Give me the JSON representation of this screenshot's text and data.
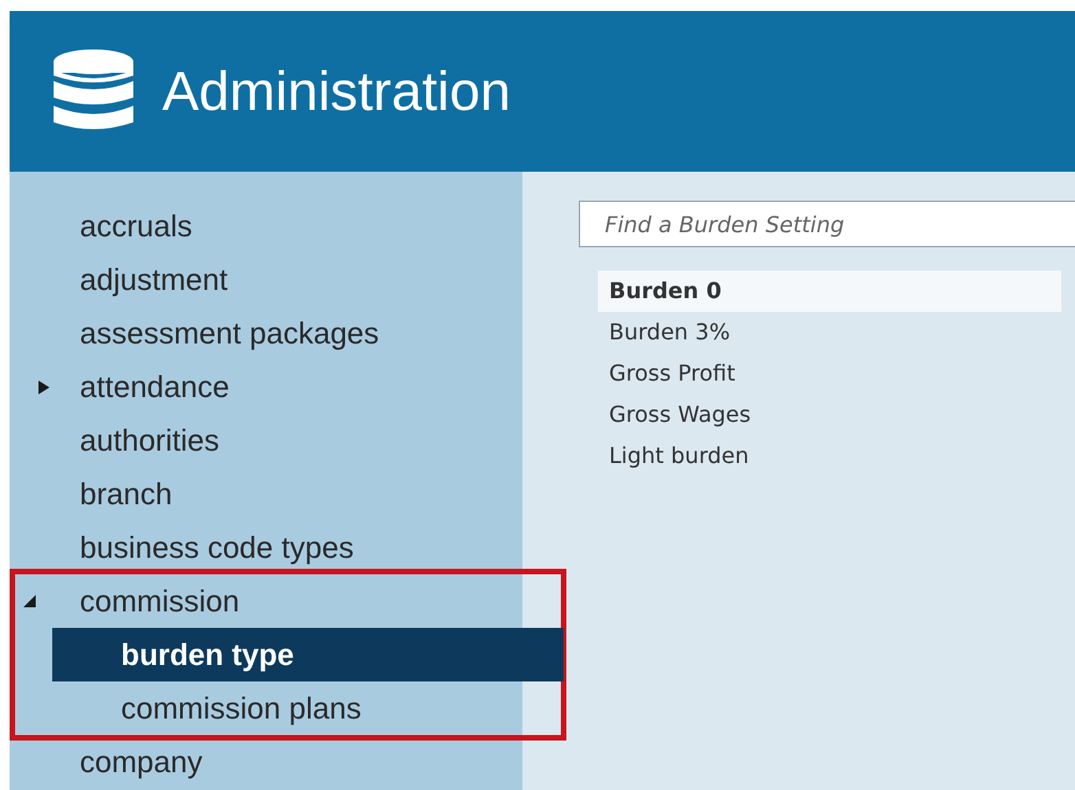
{
  "header": {
    "title": "Administration"
  },
  "sidebar": {
    "items": [
      {
        "label": "accruals",
        "kind": "leaf",
        "selected": false
      },
      {
        "label": "adjustment",
        "kind": "leaf",
        "selected": false
      },
      {
        "label": "assessment packages",
        "kind": "leaf",
        "selected": false
      },
      {
        "label": "attendance",
        "kind": "folder",
        "expanded": false,
        "selected": false
      },
      {
        "label": "authorities",
        "kind": "leaf",
        "selected": false
      },
      {
        "label": "branch",
        "kind": "leaf",
        "selected": false
      },
      {
        "label": "business code types",
        "kind": "leaf",
        "selected": false
      },
      {
        "label": "commission",
        "kind": "folder",
        "expanded": true,
        "highlighted": true,
        "selected": false,
        "children": [
          {
            "label": "burden type",
            "kind": "leaf",
            "selected": true
          },
          {
            "label": "commission plans",
            "kind": "leaf",
            "selected": false
          }
        ]
      },
      {
        "label": "company",
        "kind": "leaf",
        "selected": false
      }
    ]
  },
  "content": {
    "search": {
      "placeholder": "Find a Burden Setting"
    },
    "items": [
      {
        "label": "Burden 0",
        "selected": true
      },
      {
        "label": "Burden 3%",
        "selected": false
      },
      {
        "label": "Gross Profit",
        "selected": false
      },
      {
        "label": "Gross Wages",
        "selected": false
      },
      {
        "label": "Light burden",
        "selected": false
      }
    ]
  }
}
